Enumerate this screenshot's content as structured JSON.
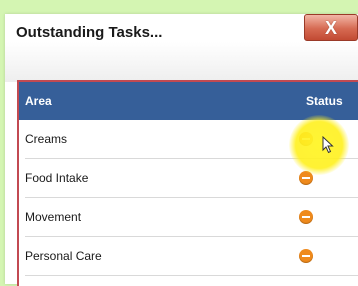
{
  "dialog": {
    "title": "Outstanding Tasks...",
    "close_label": "X"
  },
  "table": {
    "columns": [
      "Area",
      "Status"
    ],
    "rows": [
      {
        "area": "Creams",
        "status_icon": "minus-circle-icon",
        "status_color": "#ef8a1c"
      },
      {
        "area": "Food Intake",
        "status_icon": "minus-circle-icon",
        "status_color": "#ef8a1c"
      },
      {
        "area": "Movement",
        "status_icon": "minus-circle-icon",
        "status_color": "#ef8a1c"
      },
      {
        "area": "Personal Care",
        "status_icon": "minus-circle-icon",
        "status_color": "#ef8a1c"
      }
    ]
  },
  "colors": {
    "header_bg": "#365f99",
    "table_border": "#c24a52",
    "page_bg": "#d4f5b2"
  }
}
